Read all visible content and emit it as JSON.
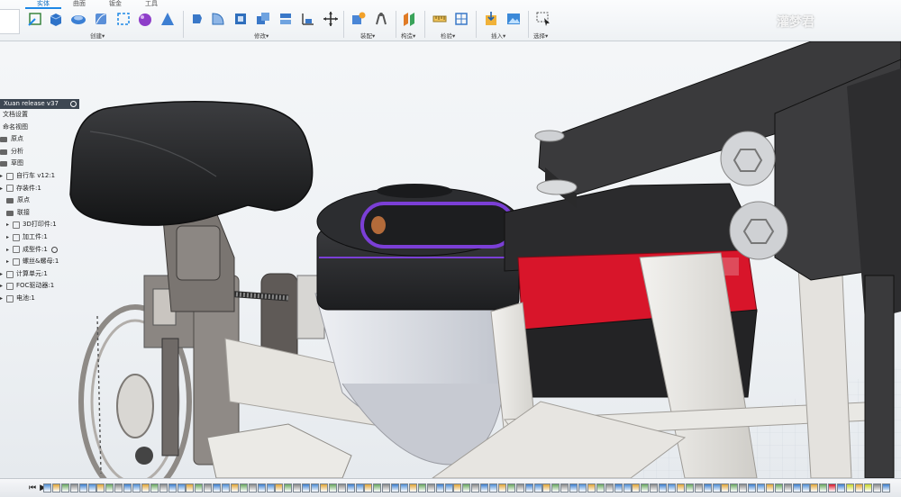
{
  "ribbon": {
    "tabs": [
      "实体",
      "曲面",
      "钣金",
      "工具"
    ],
    "groups": [
      "创建▾",
      "修改▾",
      "装配▾",
      "构造▾",
      "检验▾",
      "插入▾",
      "选择▾"
    ]
  },
  "watermark": "灌梦君",
  "browser": {
    "title": "Xuan release v37",
    "items": [
      {
        "label": "文档设置",
        "indent": 0,
        "arrow": false,
        "icon": "none"
      },
      {
        "label": "命名视图",
        "indent": 0,
        "arrow": false,
        "icon": "none"
      },
      {
        "label": "原点",
        "indent": 0,
        "arrow": false,
        "icon": "folder"
      },
      {
        "label": "分析",
        "indent": 0,
        "arrow": false,
        "icon": "folder"
      },
      {
        "label": "草图",
        "indent": 0,
        "arrow": false,
        "icon": "folder"
      },
      {
        "label": "自行车 v12:1",
        "indent": 0,
        "arrow": true,
        "icon": "component"
      },
      {
        "label": "存装件:1",
        "indent": 0,
        "arrow": true,
        "icon": "component"
      },
      {
        "label": "原点",
        "indent": 1,
        "arrow": false,
        "icon": "folder"
      },
      {
        "label": "联接",
        "indent": 1,
        "arrow": false,
        "icon": "folder"
      },
      {
        "label": "3D打印件:1",
        "indent": 1,
        "arrow": true,
        "icon": "component"
      },
      {
        "label": "加工件:1",
        "indent": 1,
        "arrow": true,
        "icon": "component"
      },
      {
        "label": "成型件:1",
        "indent": 1,
        "arrow": true,
        "icon": "component",
        "eye": true
      },
      {
        "label": "螺丝&螺母:1",
        "indent": 1,
        "arrow": true,
        "icon": "component"
      },
      {
        "label": "计算单元:1",
        "indent": 0,
        "arrow": true,
        "icon": "component"
      },
      {
        "label": "FOC驱动器:1",
        "indent": 0,
        "arrow": true,
        "icon": "component"
      },
      {
        "label": "电池:1",
        "indent": 0,
        "arrow": true,
        "icon": "component"
      }
    ]
  },
  "navbar": {
    "icons": [
      "orbit-icon",
      "look-at-icon",
      "pan-icon",
      "zoom-icon",
      "zoom-window-icon",
      "display-settings-icon",
      "grid-icon",
      "viewports-icon"
    ],
    "glyphs": [
      "✥",
      "⬚",
      "✋",
      "⊕",
      "⌕",
      "▣",
      "▦",
      "▤"
    ]
  },
  "timeline": {
    "controls": [
      "⏮",
      "▶",
      "⏭"
    ],
    "item_count": 95
  },
  "colors": {
    "accent": "#1e88e5",
    "seat": "#2b2c2e",
    "body_gray": "#6a6563",
    "hub_purple": "#7b3fd6",
    "battery_red": "#d8152a",
    "frame_white": "#e4e3e0"
  }
}
